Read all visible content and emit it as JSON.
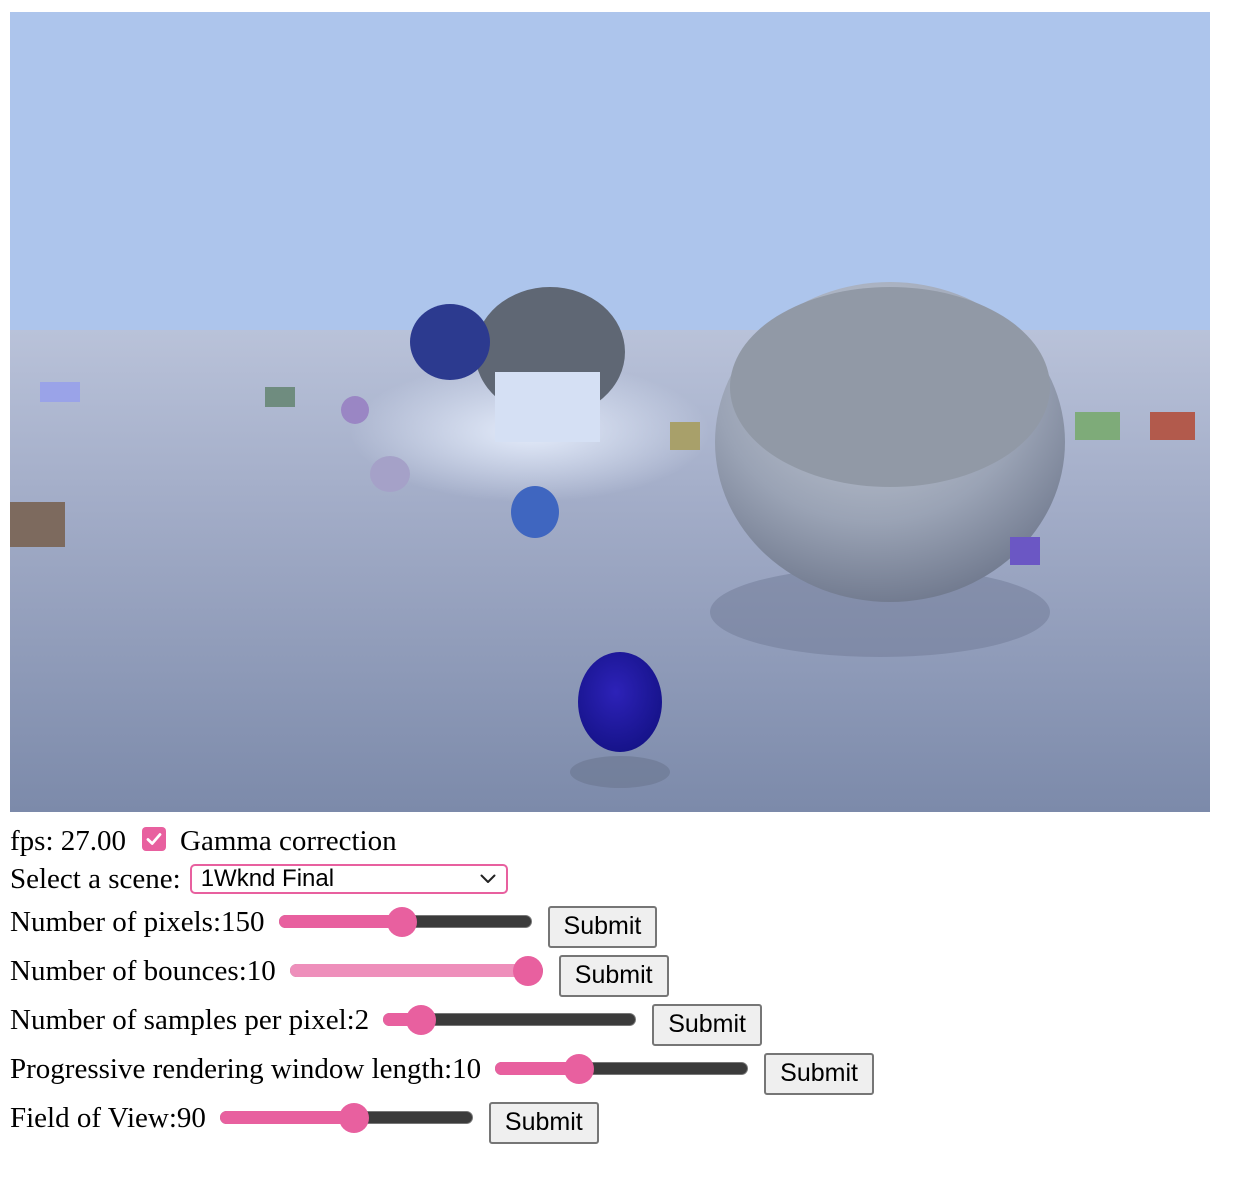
{
  "fps_label": "fps: 27.00",
  "gamma": {
    "label": "Gamma correction",
    "checked": true
  },
  "scene": {
    "label": "Select a scene:",
    "selected": "1Wknd Final"
  },
  "controls": [
    {
      "id": "pixels",
      "label": "Number of pixels:150",
      "value_fraction": 0.49,
      "style": "normal",
      "button": "Submit"
    },
    {
      "id": "bounces",
      "label": "Number of bounces:10",
      "value_fraction": 0.94,
      "style": "light",
      "button": "Submit"
    },
    {
      "id": "samples",
      "label": "Number of samples per pixel:2",
      "value_fraction": 0.15,
      "style": "normal",
      "button": "Submit"
    },
    {
      "id": "window",
      "label": "Progressive rendering window length:10",
      "value_fraction": 0.33,
      "style": "normal",
      "button": "Submit"
    },
    {
      "id": "fov",
      "label": "Field of View:90",
      "value_fraction": 0.53,
      "style": "normal",
      "button": "Submit"
    }
  ],
  "colors": {
    "accent": "#e8609f",
    "accent_light": "#ee8fbb",
    "sky": "#adc5ec",
    "ground": "#8896b5"
  }
}
